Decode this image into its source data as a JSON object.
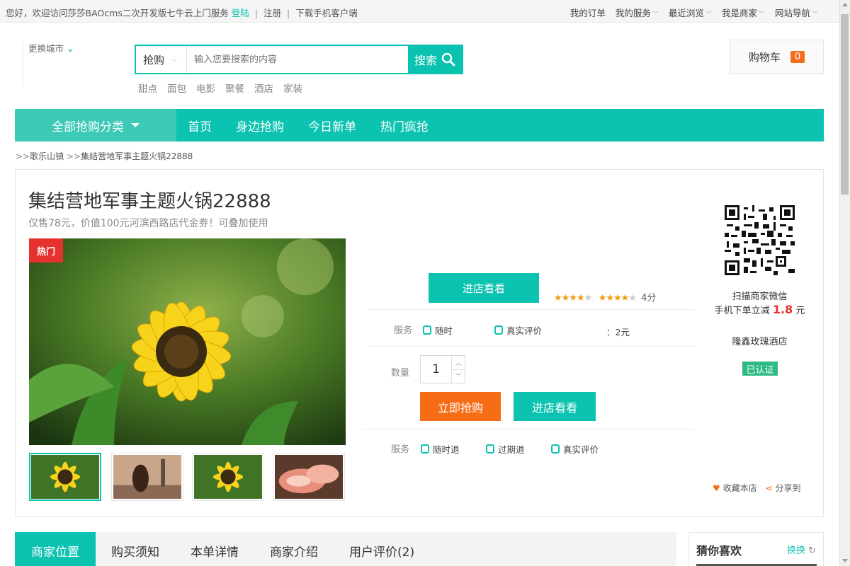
{
  "topbar": {
    "welcome": "您好，欢迎访问莎莎BAOcms二次开发版七牛云上门服务",
    "login": "登陆",
    "register": "注册",
    "app": "下载手机客户端",
    "links": [
      "我的订单",
      "我的服务",
      "最近浏览",
      "我是商家",
      "网站导航"
    ]
  },
  "header": {
    "city": "更换城市",
    "search": {
      "category": "抢购",
      "placeholder": "输入您要搜索的内容",
      "button": "搜索"
    },
    "hotwords": [
      "甜点",
      "面包",
      "电影",
      "聚餐",
      "酒店",
      "家装"
    ],
    "cart": {
      "label": "购物车",
      "count": "0"
    }
  },
  "nav": {
    "all": "全部抢购分类",
    "items": [
      "首页",
      "身边抢购",
      "今日新单",
      "热门疯抢"
    ]
  },
  "breadcrumb": {
    "sep": ">>",
    "items": [
      "歌乐山镇",
      "集结营地军事主题火锅22888"
    ]
  },
  "product": {
    "title": "集结营地军事主题火锅22888",
    "subtitle": "仅售78元，价值100元河滨西路店代金券！可叠加使用",
    "badge": "热门",
    "enter_shop": "进店看看",
    "rating": {
      "score_label": "4分",
      "score": 4,
      "max": 5
    },
    "service_label": "服务",
    "services_top": [
      "随时",
      "真实评价"
    ],
    "reduce_text": "：2元",
    "quantity_label": "数量",
    "quantity": "1",
    "buy_label": "立即抢购",
    "enter_shop2": "进店看看",
    "services": [
      "随时退",
      "过期退",
      "真实评价"
    ]
  },
  "merchant": {
    "qr_caption": "扫描商家微信",
    "discount_prefix": "手机下单立减",
    "discount_amount": "1.8",
    "discount_suffix": "元",
    "name": "隆鑫玫瑰酒店",
    "verified": "已认证",
    "favorite": "收藏本店",
    "share": "分享到"
  },
  "tabs": [
    "商家位置",
    "购买须知",
    "本单详情",
    "商家介绍",
    "用户评价(2)"
  ],
  "guess": {
    "title": "猜你喜欢",
    "refresh": "换换"
  },
  "colors": {
    "accent": "#0bc3b0",
    "buy": "#f56d14",
    "hot": "#e6322e"
  }
}
